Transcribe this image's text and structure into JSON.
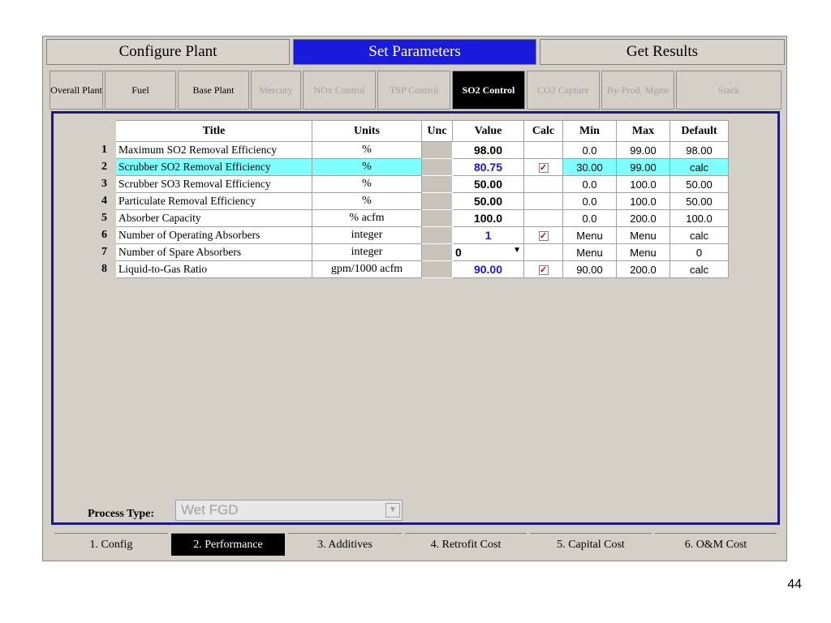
{
  "main_tabs": [
    "Configure Plant",
    "Set Parameters",
    "Get Results"
  ],
  "sub_tabs": [
    "Overall Plant",
    "Fuel",
    "Base Plant",
    "Mercury",
    "NOx Control",
    "TSP Control",
    "SO2 Control",
    "CO2 Capture",
    "By-Prod. Mgmt",
    "Stack"
  ],
  "headers": {
    "title": "Title",
    "units": "Units",
    "unc": "Unc",
    "value": "Value",
    "calc": "Calc",
    "min": "Min",
    "max": "Max",
    "default": "Default"
  },
  "rows": [
    {
      "n": "1",
      "title": "Maximum SO2 Removal Efficiency",
      "units": "%",
      "value": "98.00",
      "calc": false,
      "min": "0.0",
      "max": "99.00",
      "default": "98.00"
    },
    {
      "n": "2",
      "title": "Scrubber SO2 Removal Efficiency",
      "units": "%",
      "value": "80.75",
      "calc": true,
      "min": "30.00",
      "max": "99.00",
      "default": "calc"
    },
    {
      "n": "3",
      "title": "Scrubber SO3 Removal Efficiency",
      "units": "%",
      "value": "50.00",
      "calc": false,
      "min": "0.0",
      "max": "100.0",
      "default": "50.00"
    },
    {
      "n": "4",
      "title": "Particulate Removal Efficiency",
      "units": "%",
      "value": "50.00",
      "calc": false,
      "min": "0.0",
      "max": "100.0",
      "default": "50.00"
    },
    {
      "n": "5",
      "title": "Absorber Capacity",
      "units": "% acfm",
      "value": "100.0",
      "calc": false,
      "min": "0.0",
      "max": "200.0",
      "default": "100.0"
    },
    {
      "n": "6",
      "title": "Number of Operating Absorbers",
      "units": "integer",
      "value": "1",
      "calc": true,
      "min": "Menu",
      "max": "Menu",
      "default": "calc"
    },
    {
      "n": "7",
      "title": "Number of Spare Absorbers",
      "units": "integer",
      "value": "0",
      "calc": false,
      "min": "Menu",
      "max": "Menu",
      "default": "0"
    },
    {
      "n": "8",
      "title": "Liquid-to-Gas Ratio",
      "units": "gpm/1000 acfm",
      "value": "90.00",
      "calc": true,
      "min": "90.00",
      "max": "200.0",
      "default": "calc"
    }
  ],
  "process_type_label": "Process Type:",
  "process_type_value": "Wet FGD",
  "bottom_tabs": [
    "1. Config",
    "2. Performance",
    "3. Additives",
    "4. Retrofit Cost",
    "5. Capital Cost",
    "6. O&M Cost"
  ],
  "page_number": "44"
}
